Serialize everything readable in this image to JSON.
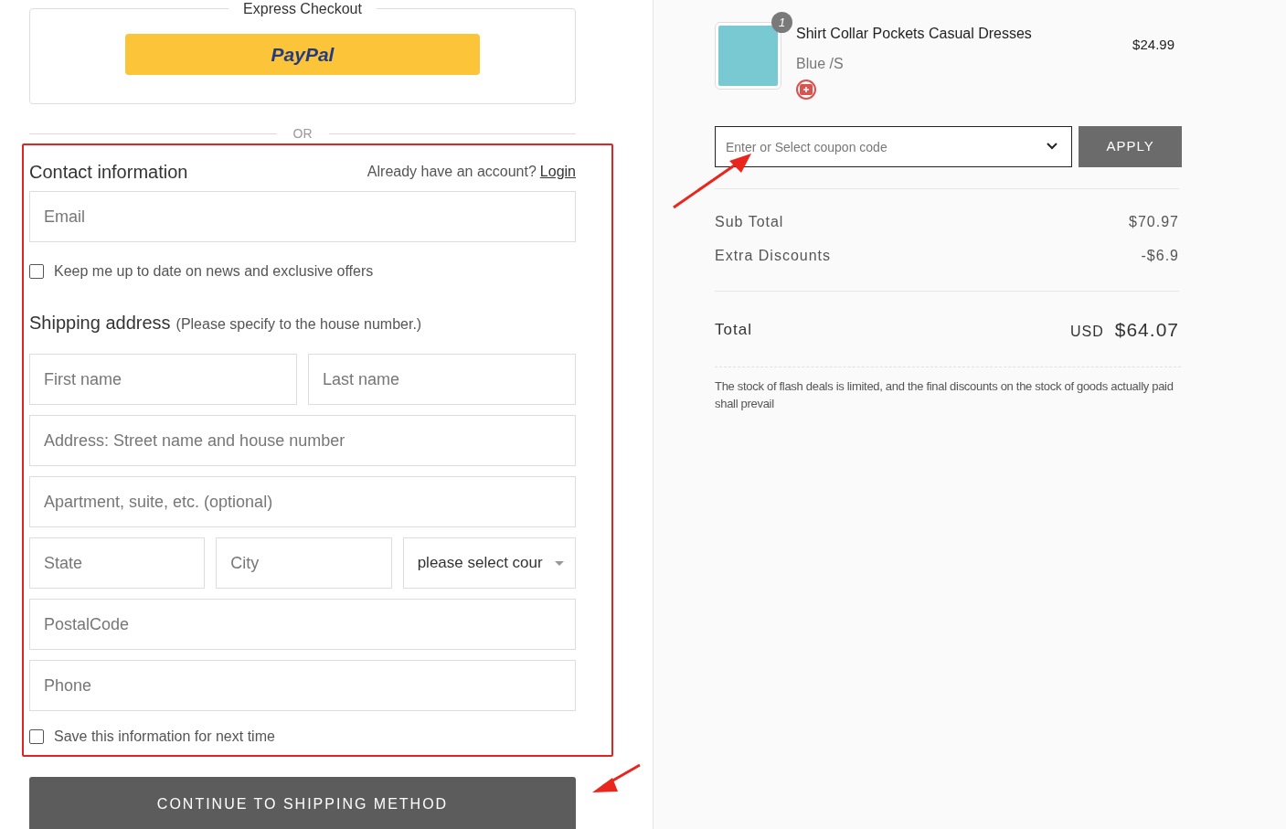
{
  "express_checkout": {
    "legend": "Express Checkout",
    "paypal_button": "PayPal"
  },
  "divider_label": "OR",
  "contact": {
    "title": "Contact information",
    "account_prompt": "Already have an account?",
    "login_link": "Login",
    "email": {
      "placeholder": "Email"
    },
    "newsletter": {
      "label": "Keep me up to date on news and exclusive offers",
      "checked": false
    }
  },
  "shipping": {
    "title": "Shipping address",
    "hint": "(Please specify to the house number.)",
    "rows": [
      [
        {
          "kind": "input",
          "placeholder": "First name"
        },
        {
          "kind": "input",
          "placeholder": "Last name"
        }
      ],
      [
        {
          "kind": "input",
          "placeholder": "Address: Street name and house number"
        }
      ],
      [
        {
          "kind": "input",
          "placeholder": "Apartment, suite, etc. (optional)"
        }
      ],
      [
        {
          "kind": "input",
          "placeholder": "State"
        },
        {
          "kind": "input",
          "placeholder": "City"
        },
        {
          "kind": "select",
          "value": "please select cour"
        }
      ],
      [
        {
          "kind": "input",
          "placeholder": "PostalCode"
        }
      ],
      [
        {
          "kind": "input",
          "placeholder": "Phone"
        }
      ]
    ],
    "save_info": {
      "label": "Save this information for next time",
      "checked": false
    }
  },
  "continue_button": "CONTINUE TO SHIPPING METHOD",
  "product": {
    "title": "Shirt Collar Pockets Casual Dresses",
    "variant": "Blue /S",
    "price": "$24.99",
    "quantity": "1"
  },
  "coupon": {
    "placeholder": "Enter or Select coupon code",
    "button": "APPLY"
  },
  "summary": [
    {
      "label": "Sub Total",
      "value": "$70.97"
    },
    {
      "label": "Extra Discounts",
      "value": "-$6.9"
    }
  ],
  "total": {
    "label": "Total",
    "currency": "USD",
    "amount": "$64.07"
  },
  "note": "The stock of flash deals is limited, and the final discounts on the stock of goods actually paid shall prevail"
}
